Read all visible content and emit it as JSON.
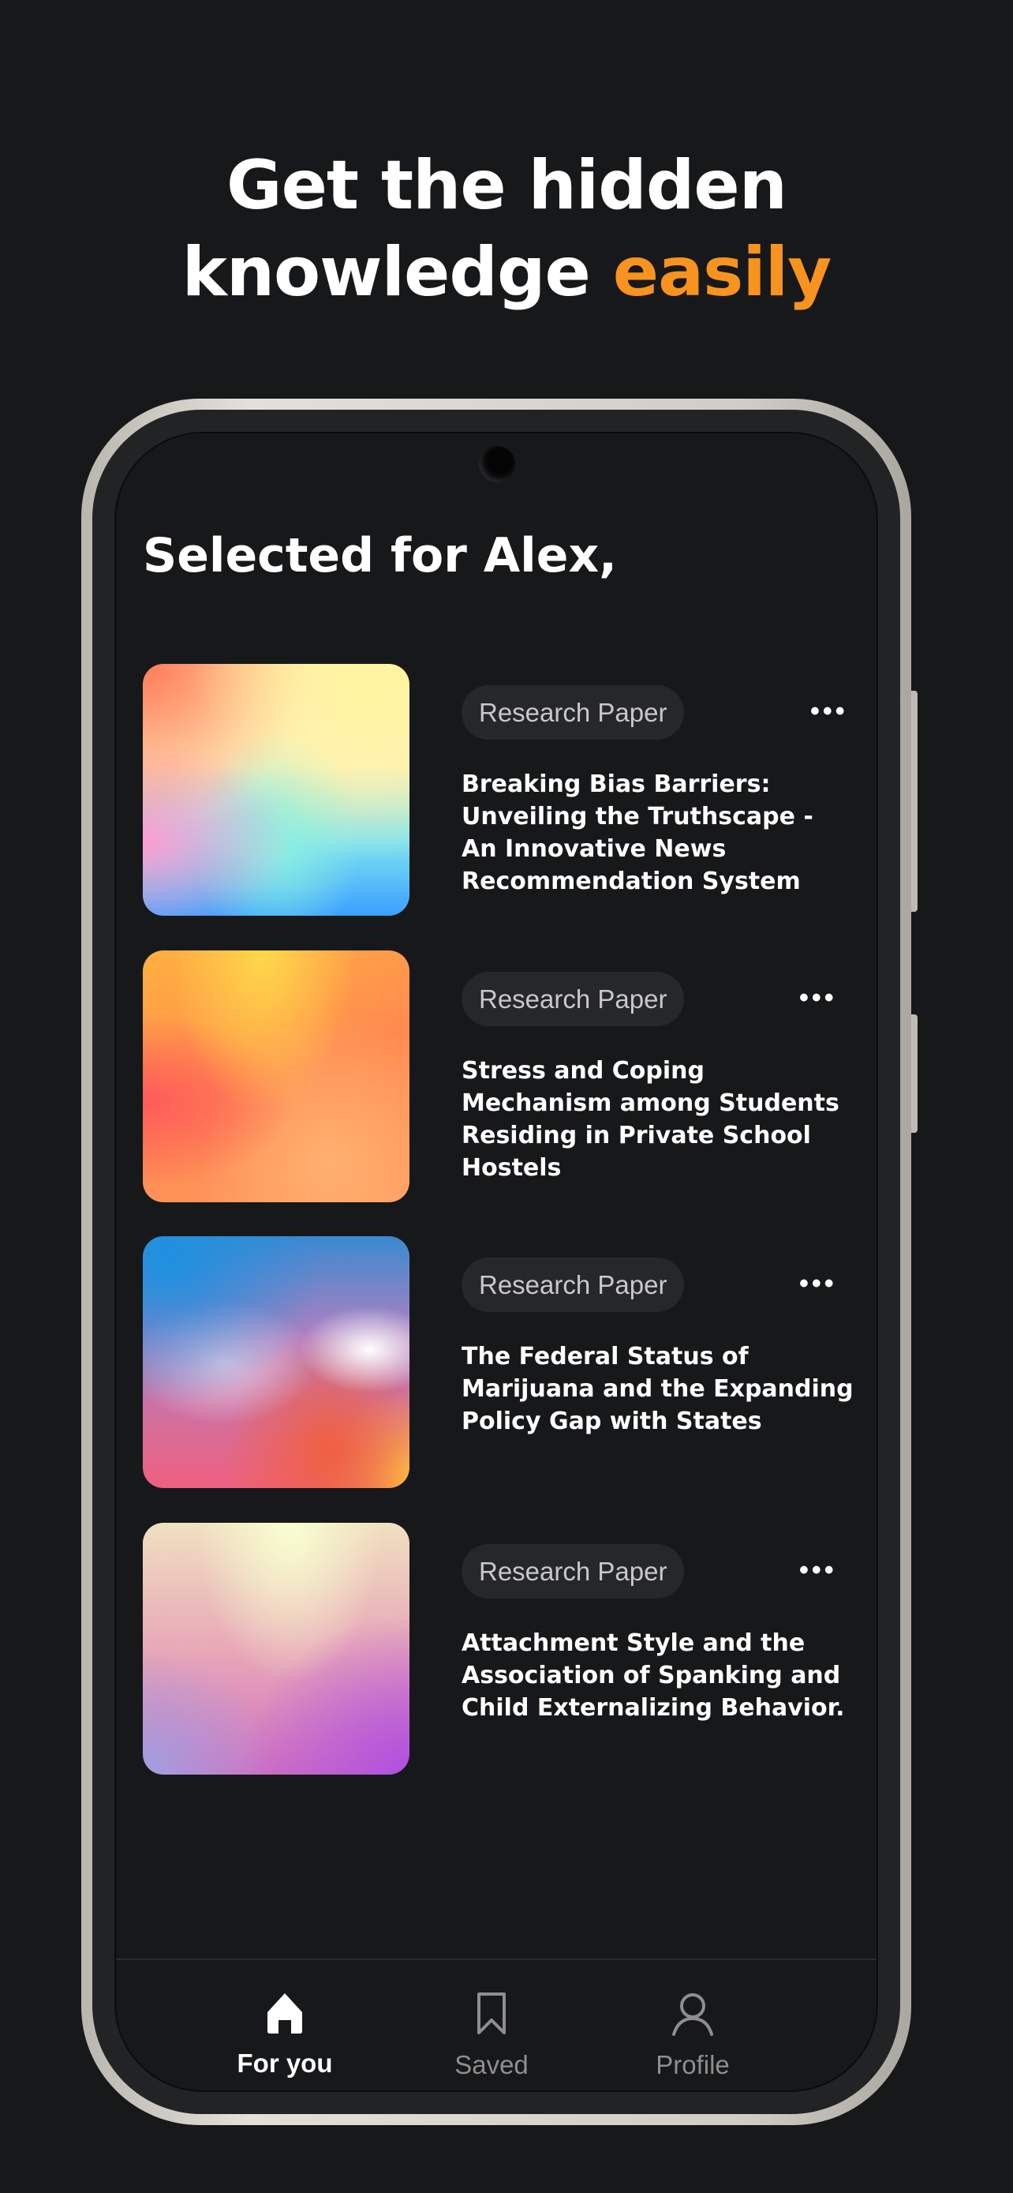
{
  "headline": {
    "line1": "Get the hidden",
    "line2_prefix": "knowledge ",
    "line2_accent": "easily",
    "accent_color": "#f7931e"
  },
  "screen": {
    "greeting": "Selected for Alex,",
    "items": [
      {
        "tag": "Research Paper",
        "title": "Breaking Bias Barriers: Unveiling the Truthscape - An Innovative News Recommendation System",
        "menu_icon": "more-horizontal-icon"
      },
      {
        "tag": "Research Paper",
        "title": "Stress and Coping Mechanism among Students Residing in Private School Hostels",
        "menu_icon": "more-horizontal-icon"
      },
      {
        "tag": "Research Paper",
        "title": "The Federal Status of Marijuana and the Expanding Policy Gap with States",
        "menu_icon": "more-horizontal-icon"
      },
      {
        "tag": "Research Paper",
        "title": "Attachment Style and the Association of Spanking and Child Externalizing Behavior.",
        "menu_icon": "more-horizontal-icon"
      }
    ],
    "nav": [
      {
        "label": "For you",
        "icon": "home-icon",
        "active": true
      },
      {
        "label": "Saved",
        "icon": "bookmark-icon",
        "active": false
      },
      {
        "label": "Profile",
        "icon": "user-icon",
        "active": false
      }
    ]
  }
}
